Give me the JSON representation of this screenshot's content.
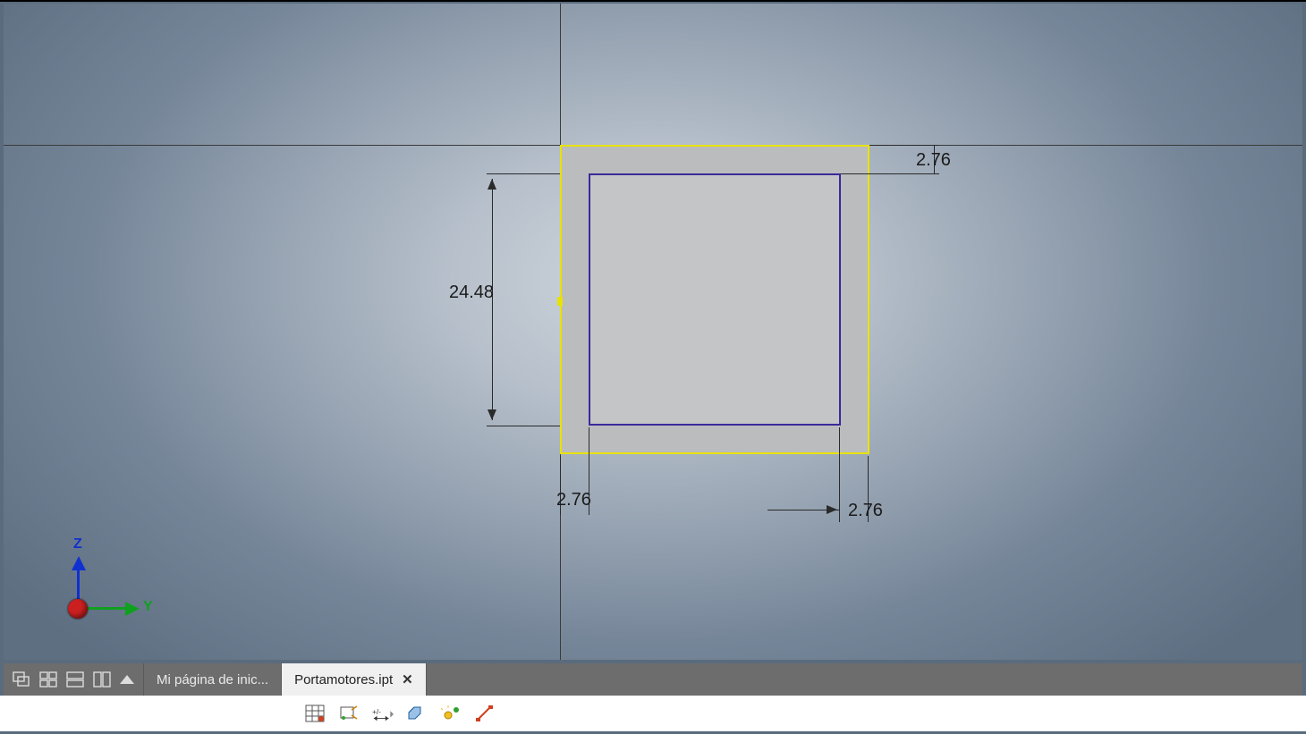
{
  "dimensions": {
    "height": "24.48",
    "offset_top_right": "2.76",
    "offset_bottom_left": "2.76",
    "offset_bottom_right": "2.76"
  },
  "ucs": {
    "z_label": "Z",
    "y_label": "Y"
  },
  "tabs": {
    "home": "Mi página de inic...",
    "active": "Portamotores.ipt"
  }
}
